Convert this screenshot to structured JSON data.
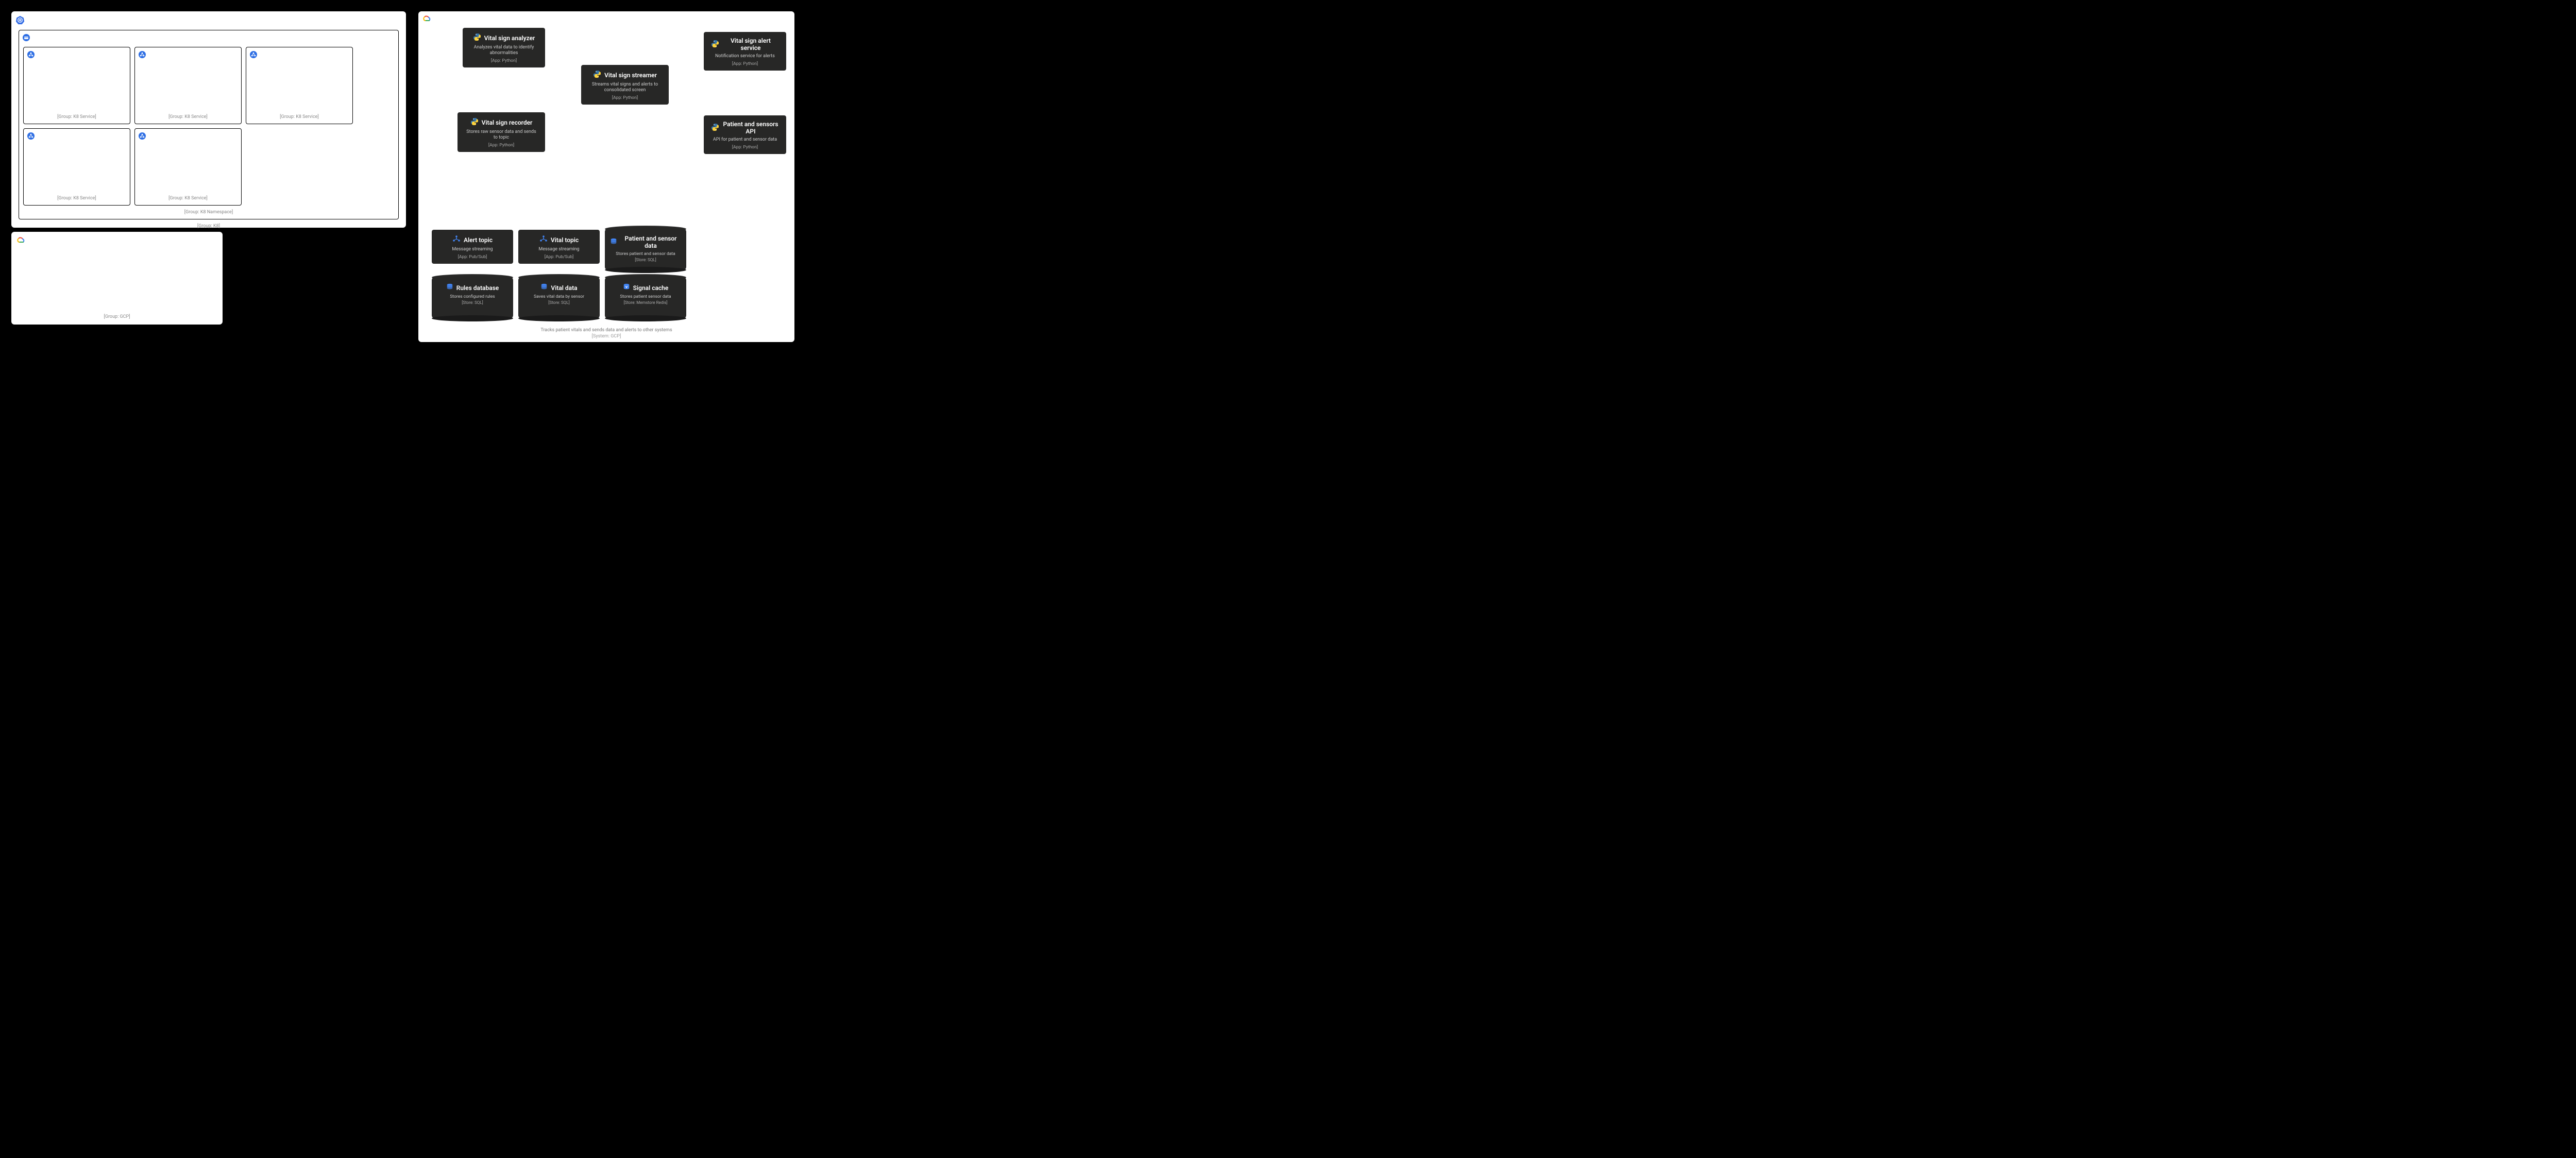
{
  "k8": {
    "group_label": "[Group: K8]",
    "namespace_label": "[Group: K8 Namespace]",
    "service_label": "[Group: K8 Service]"
  },
  "gcp_small": {
    "group_label": "[Group: GCP]"
  },
  "gcp_large": {
    "description": "Tracks patient vitals and sends data and alerts to other systems",
    "system_label": "[System: GCP]",
    "apps": {
      "analyzer": {
        "title": "Vital sign analyzer",
        "desc": "Analyzes vital data to identify abnormalities",
        "meta": "[App: Python]"
      },
      "alert_service": {
        "title": "Vital sign alert service",
        "desc": "Notification service for alerts",
        "meta": "[App: Python]"
      },
      "streamer": {
        "title": "Vital sign streamer",
        "desc": "Streams vital signs and alerts to consolidated screen",
        "meta": "[App: Python]"
      },
      "recorder": {
        "title": "Vital sign recorder",
        "desc": "Stores raw sensor data and sends to topic",
        "meta": "[App: Python]"
      },
      "patient_api": {
        "title": "Patient and sensors API",
        "desc": "API for patient and sensor data",
        "meta": "[App: Python]"
      },
      "alert_topic": {
        "title": "Alert topic",
        "desc": "Message streaming",
        "meta": "[App: Pub/Sub]"
      },
      "vital_topic": {
        "title": "Vital topic",
        "desc": "Message streaming",
        "meta": "[App: Pub/Sub]"
      }
    },
    "stores": {
      "patient_sensor": {
        "title": "Patient and sensor data",
        "desc": "Stores patient and sensor data",
        "meta": "[Store: SQL]"
      },
      "rules_db": {
        "title": "Rules database",
        "desc": "Stores configured rules",
        "meta": "[Store: SQL]"
      },
      "vital_data": {
        "title": "Vital data",
        "desc": "Saves vital data by sensor",
        "meta": "[Store: SQL]"
      },
      "signal_cache": {
        "title": "Signal cache",
        "desc": "Stores patient sensor data",
        "meta": "[Store: Memstore Redis]"
      }
    }
  }
}
